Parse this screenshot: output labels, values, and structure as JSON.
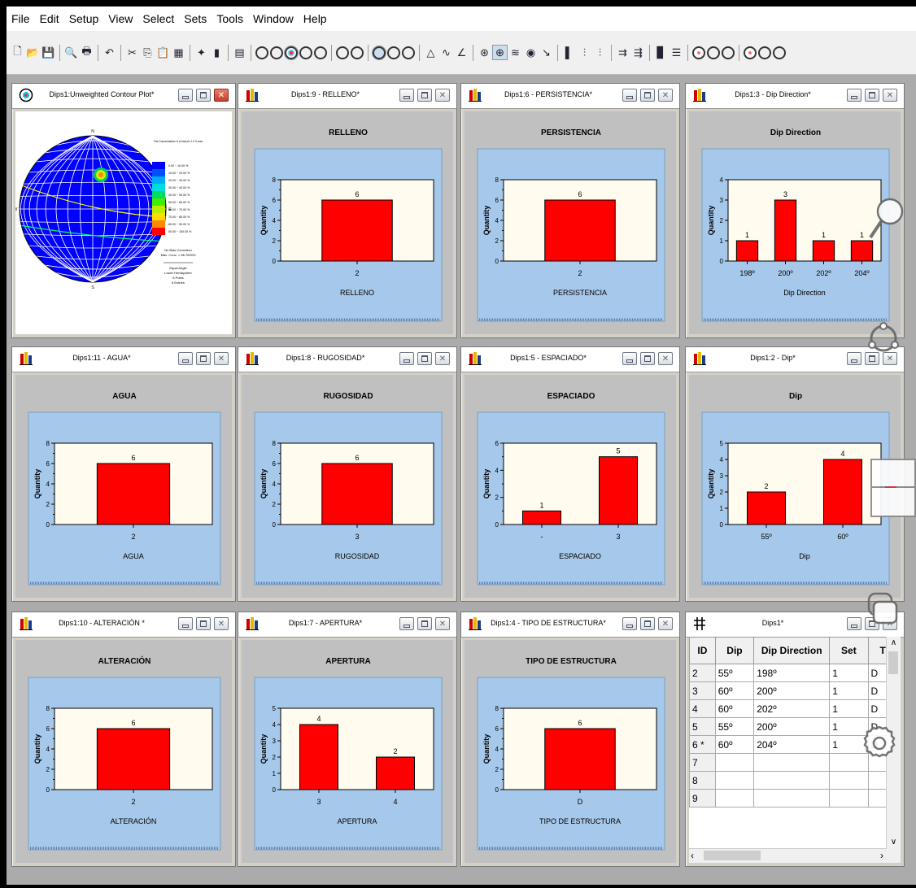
{
  "menu": [
    "File",
    "Edit",
    "Setup",
    "View",
    "Select",
    "Sets",
    "Tools",
    "Window",
    "Help"
  ],
  "toolbar": {
    "icons": [
      "new-file-icon",
      "open-folder-icon",
      "save-icon",
      "print-preview-icon",
      "print-icon",
      "undo-icon",
      "cut-icon",
      "copy-icon",
      "paste-icon",
      "spreadsheet-icon",
      "wizard-icon",
      "chart-icon",
      "info-icon",
      "pole-plot-icon",
      "scatter-plot-icon",
      "contour-plot-icon",
      "rosette-icon",
      "stereonet-icon",
      "add-plane-icon",
      "add-pole-icon",
      "set-window-icon",
      "intersection-icon",
      "contour-options-icon",
      "cone-icon",
      "tilde-icon",
      "angle-icon",
      "rotate-icon",
      "grid-icon",
      "clamp-icon",
      "tool-icon",
      "arrow-tool-icon",
      "histogram-icon",
      "filter-icon",
      "filter2-icon",
      "merge-icon",
      "split-icon",
      "stats-icon",
      "legend-icon",
      "view1-icon",
      "view2-icon",
      "view3-icon",
      "view4-icon",
      "view5-icon",
      "view6-icon"
    ]
  },
  "stereonet": {
    "title": "Dips1:Unweighted Contour Plot*",
    "legend_title": "Pole Concentrations % of total per 1.0 % area",
    "legend_items": [
      "0.00 ~ 10.00 %",
      "10.00 ~ 20.00 %",
      "20.00 ~ 30.00 %",
      "30.00 ~ 40.00 %",
      "40.00 ~ 50.00 %",
      "50.00 ~ 60.00 %",
      "60.00 ~ 70.00 %",
      "70.00 ~ 80.00 %",
      "80.00 ~ 90.00 %",
      "90.00 ~ 100.00 %"
    ],
    "legend_colors": [
      "#0000ff",
      "#0050ff",
      "#00aaff",
      "#00dddd",
      "#00dd66",
      "#44ee00",
      "#bbee00",
      "#ffdd00",
      "#ff8800",
      "#ff0000"
    ],
    "fisher": "No Bias Correction",
    "maxconc": "Max. Conc. = 66.7000%",
    "proj1": "Equal Angle",
    "proj2": "Lower Hemisphere",
    "proj3": "6 Poles",
    "proj4": "6 Entries",
    "labels": {
      "n": "N",
      "s": "S",
      "w": "W",
      "e": "E"
    }
  },
  "charts": [
    {
      "title": "Dips1:9 - RELLENO*",
      "chart_data": {
        "type": "bar",
        "title": "RELLENO",
        "xlabel": "RELLENO",
        "ylabel": "Quantity",
        "categories": [
          "2"
        ],
        "values": [
          6
        ],
        "ylim": [
          0,
          8
        ],
        "ticks": [
          0,
          2,
          4,
          6,
          8
        ],
        "minor_ticks": true
      }
    },
    {
      "title": "Dips1:6 - PERSISTENCIA*",
      "chart_data": {
        "type": "bar",
        "title": "PERSISTENCIA",
        "xlabel": "PERSISTENCIA",
        "ylabel": "Quantity",
        "categories": [
          "2"
        ],
        "values": [
          6
        ],
        "ylim": [
          0,
          8
        ],
        "ticks": [
          0,
          2,
          4,
          6,
          8
        ],
        "minor_ticks": true
      }
    },
    {
      "title": "Dips1:3 - Dip Direction*",
      "chart_data": {
        "type": "bar",
        "title": "Dip Direction",
        "xlabel": "Dip Direction",
        "ylabel": "Quantity",
        "categories": [
          "198º",
          "200º",
          "202º",
          "204º"
        ],
        "values": [
          1,
          3,
          1,
          1
        ],
        "ylim": [
          0,
          4
        ],
        "ticks": [
          0,
          1,
          2,
          3,
          4
        ],
        "minor_ticks": false
      }
    },
    {
      "title": "Dips1:11 - AGUA*",
      "chart_data": {
        "type": "bar",
        "title": "AGUA",
        "xlabel": "AGUA",
        "ylabel": "Quantity",
        "categories": [
          "2"
        ],
        "values": [
          6
        ],
        "ylim": [
          0,
          8
        ],
        "ticks": [
          0,
          2,
          4,
          6,
          8
        ],
        "minor_ticks": true
      }
    },
    {
      "title": "Dips1:8 - RUGOSIDAD*",
      "chart_data": {
        "type": "bar",
        "title": "RUGOSIDAD",
        "xlabel": "RUGOSIDAD",
        "ylabel": "Quantity",
        "categories": [
          "3"
        ],
        "values": [
          6
        ],
        "ylim": [
          0,
          8
        ],
        "ticks": [
          0,
          2,
          4,
          6,
          8
        ],
        "minor_ticks": true
      }
    },
    {
      "title": "Dips1:5 - ESPACIADO*",
      "chart_data": {
        "type": "bar",
        "title": "ESPACIADO",
        "xlabel": "ESPACIADO",
        "ylabel": "Quantity",
        "categories": [
          "-",
          "3"
        ],
        "values": [
          1,
          5
        ],
        "ylim": [
          0,
          6
        ],
        "ticks": [
          0,
          2,
          4,
          6
        ],
        "minor_ticks": true
      }
    },
    {
      "title": "Dips1:2 - Dip*",
      "chart_data": {
        "type": "bar",
        "title": "Dip",
        "xlabel": "Dip",
        "ylabel": "Quantity",
        "categories": [
          "55º",
          "60º"
        ],
        "values": [
          2,
          4
        ],
        "ylim": [
          0,
          5
        ],
        "ticks": [
          0,
          1,
          2,
          3,
          4,
          5
        ],
        "minor_ticks": false
      }
    },
    {
      "title": "Dips1:10 - ALTERACIÓN *",
      "chart_data": {
        "type": "bar",
        "title": "ALTERACIÓN",
        "xlabel": "ALTERACIÓN",
        "ylabel": "Quantity",
        "categories": [
          "2"
        ],
        "values": [
          6
        ],
        "ylim": [
          0,
          8
        ],
        "ticks": [
          0,
          2,
          4,
          6,
          8
        ],
        "minor_ticks": true
      }
    },
    {
      "title": "Dips1:7 - APERTURA*",
      "chart_data": {
        "type": "bar",
        "title": "APERTURA",
        "xlabel": "APERTURA",
        "ylabel": "Quantity",
        "categories": [
          "3",
          "4"
        ],
        "values": [
          4,
          2
        ],
        "ylim": [
          0,
          5
        ],
        "ticks": [
          0,
          1,
          2,
          3,
          4,
          5
        ],
        "minor_ticks": false
      }
    },
    {
      "title": "Dips1:4 - TIPO DE ESTRUCTURA*",
      "chart_data": {
        "type": "bar",
        "title": "TIPO DE ESTRUCTURA",
        "xlabel": "TIPO DE ESTRUCTURA",
        "ylabel": "Quantity",
        "categories": [
          "D"
        ],
        "values": [
          6
        ],
        "ylim": [
          0,
          8
        ],
        "ticks": [
          0,
          2,
          4,
          6,
          8
        ],
        "minor_ticks": true
      }
    }
  ],
  "table": {
    "title": "Dips1*",
    "columns": [
      "ID",
      "Dip",
      "Dip Direction",
      "Set",
      "TI"
    ],
    "rows": [
      [
        "2",
        "55º",
        "198º",
        "1",
        "D"
      ],
      [
        "3",
        "60º",
        "200º",
        "1",
        "D"
      ],
      [
        "4",
        "60º",
        "202º",
        "1",
        "D"
      ],
      [
        "5",
        "55º",
        "200º",
        "1",
        "D"
      ],
      [
        "6 *",
        "60º",
        "204º",
        "1",
        "D"
      ],
      [
        "7",
        "",
        "",
        "",
        ""
      ],
      [
        "8",
        "",
        "",
        "",
        ""
      ],
      [
        "9",
        "",
        "",
        "",
        ""
      ]
    ]
  },
  "overlay_icons": [
    "magnifier-icon",
    "rotate-icon",
    "window-icon",
    "copy-icon",
    "gear-icon"
  ]
}
